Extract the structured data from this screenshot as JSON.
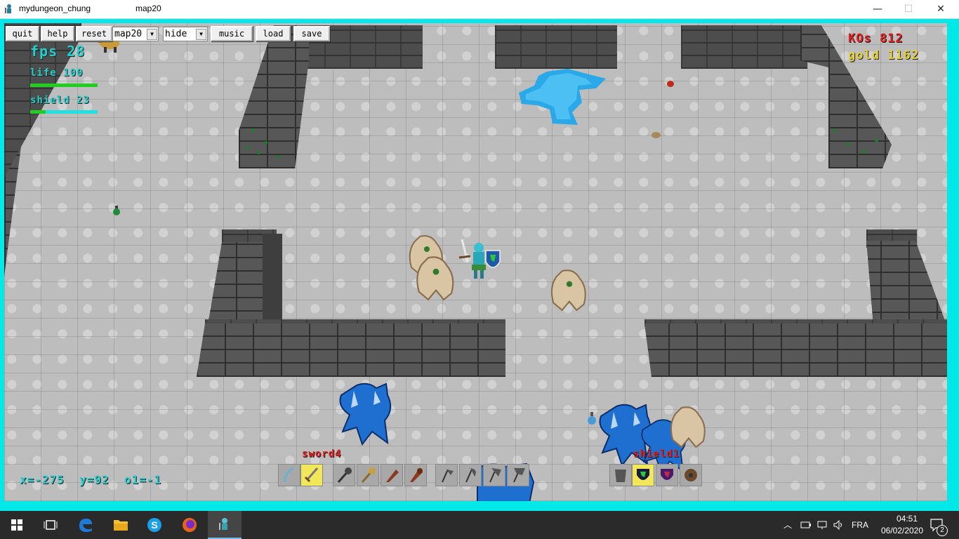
{
  "window": {
    "title": "mydungeon_chung",
    "subtitle": "map20",
    "minimize_glyph": "—",
    "maximize_glyph": "☐",
    "close_glyph": "✕"
  },
  "toolbar": {
    "quit": "quit",
    "help": "help",
    "reset": "reset",
    "map_select": "map20",
    "view_select": "hide",
    "music": "music",
    "load": "load",
    "save": "save"
  },
  "hud": {
    "fps": "fps 28",
    "life_label": "life 100",
    "life_value": 1.0,
    "shield_label": "shield 23",
    "shield_value": 0.23,
    "kos": "KOs 812",
    "gold": "gold 1162",
    "coords": "x=-275  y=92  o1=-1",
    "weapon_name": "sword4",
    "shield_name": "shield1"
  },
  "colors": {
    "frame": "#00e8e8",
    "hud_cyan": "#22d0d0",
    "life_bar": "#22cc22",
    "shield_bar": "#22e0e0",
    "kos": "#e02020",
    "gold": "#e8d030",
    "item_label": "#e02020",
    "water": "#2aa8e8"
  },
  "inventory": {
    "weapons": [
      "bow-icon",
      "sword-icon",
      "mace-icon",
      "morningstar-icon",
      "club-icon",
      "spiked-club-icon",
      "axe-icon",
      "hatchet-icon",
      "battleaxe-icon",
      "double-axe-icon"
    ],
    "selected_weapon": 1,
    "shields": [
      "armor-icon",
      "lion-shield-icon",
      "purple-shield-icon",
      "round-shield-icon"
    ],
    "selected_shield": 1
  },
  "taskbar": {
    "language": "FRA",
    "time": "04:51",
    "date": "06/02/2020",
    "notifications": "2"
  }
}
